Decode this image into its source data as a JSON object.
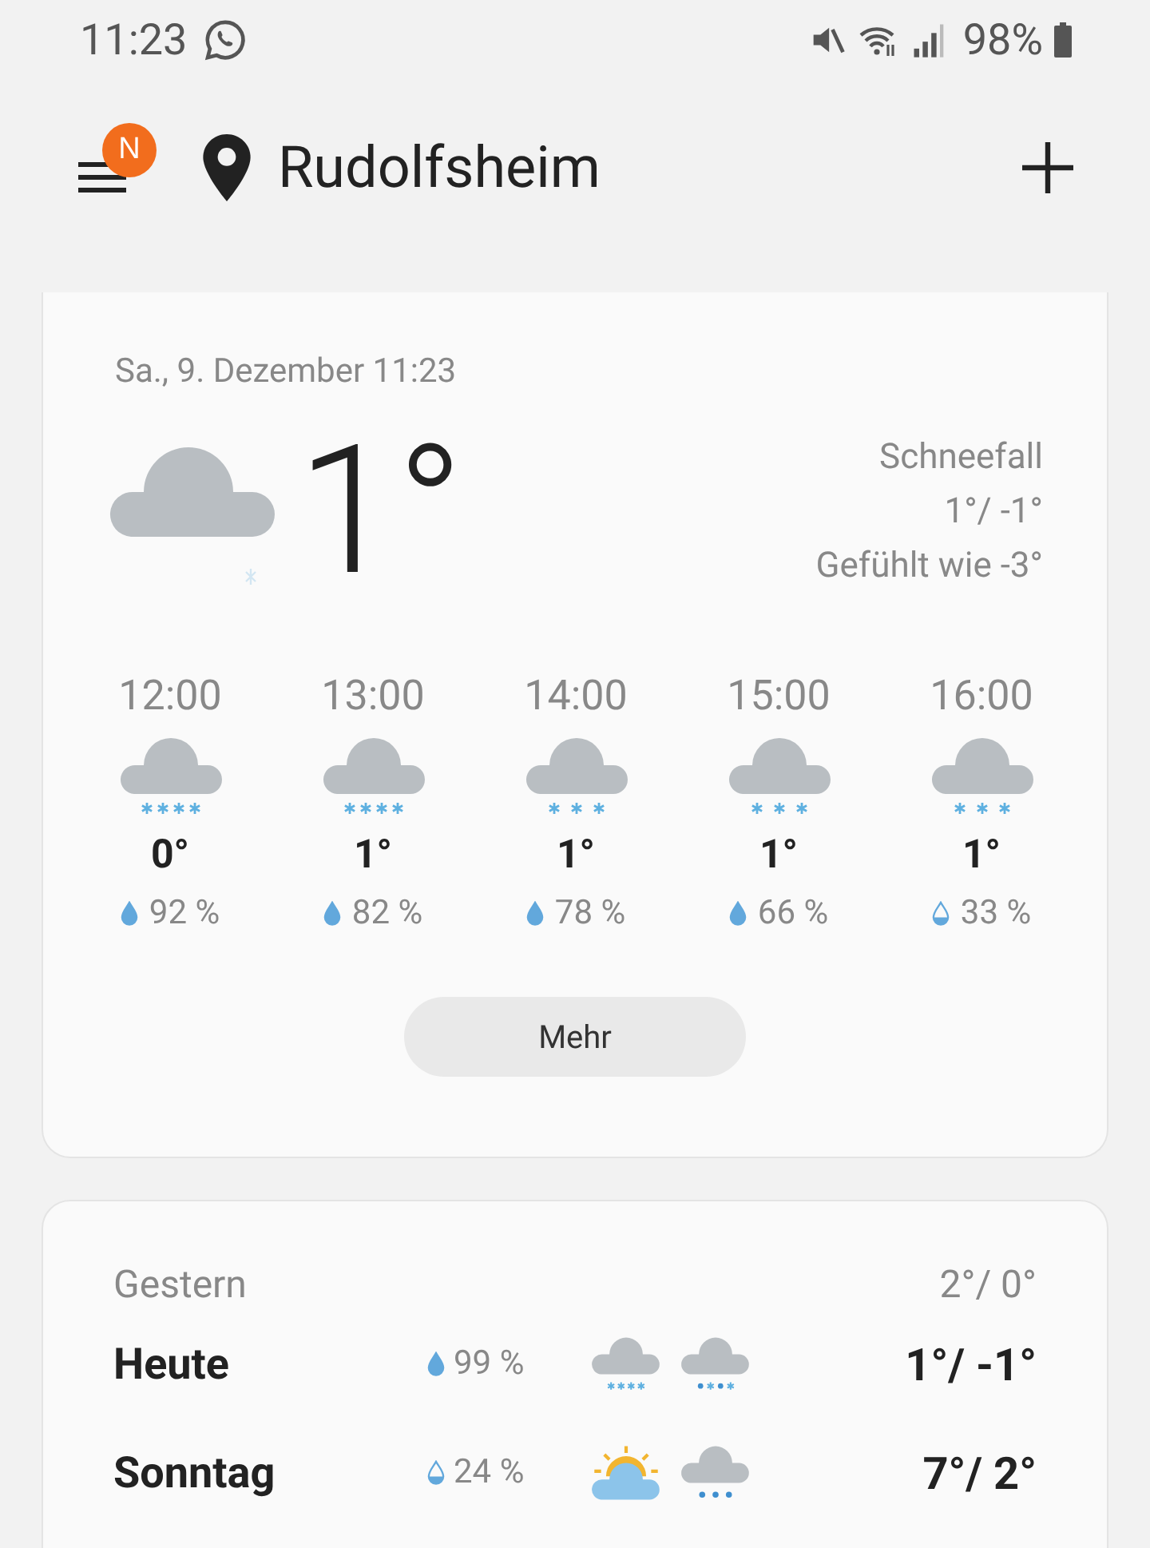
{
  "status_bar": {
    "time": "11:23",
    "battery": "98%"
  },
  "header": {
    "badge": "N",
    "location": "Rudolfsheim"
  },
  "current": {
    "date": "Sa., 9. Dezember 11:23",
    "temperature": "1°",
    "condition": "Schneefall",
    "high_low": "1°/ -1°",
    "feels_like": "Gefühlt wie -3°"
  },
  "hourly": [
    {
      "time": "12:00",
      "icon": {
        "kind": "heavy-snow"
      },
      "temperature": "0°",
      "drop": {
        "kind": "full"
      },
      "precipitation": "92 %"
    },
    {
      "time": "13:00",
      "icon": {
        "kind": "heavy-snow"
      },
      "temperature": "1°",
      "drop": {
        "kind": "full"
      },
      "precipitation": "82 %"
    },
    {
      "time": "14:00",
      "icon": {
        "kind": "snow"
      },
      "temperature": "1°",
      "drop": {
        "kind": "full"
      },
      "precipitation": "78 %"
    },
    {
      "time": "15:00",
      "icon": {
        "kind": "snow"
      },
      "temperature": "1°",
      "drop": {
        "kind": "full"
      },
      "precipitation": "66 %"
    },
    {
      "time": "16:00",
      "icon": {
        "kind": "snow"
      },
      "temperature": "1°",
      "drop": {
        "kind": "half"
      },
      "precipitation": "33 %"
    }
  ],
  "more_button": "Mehr",
  "daily": {
    "yesterday": {
      "label": "Gestern",
      "high_low": "2°/ 0°"
    },
    "days": [
      {
        "name": "Heute",
        "drop": {
          "kind": "full"
        },
        "precipitation": "99 %",
        "icons": [
          {
            "kind": "heavy-snow"
          },
          {
            "kind": "snow-rain"
          }
        ],
        "high_low": "1°/ -1°"
      },
      {
        "name": "Sonntag",
        "drop": {
          "kind": "half"
        },
        "precipitation": "24 %",
        "icons": [
          {
            "kind": "partly-sunny"
          },
          {
            "kind": "rain"
          }
        ],
        "high_low": "7°/ 2°"
      }
    ]
  }
}
